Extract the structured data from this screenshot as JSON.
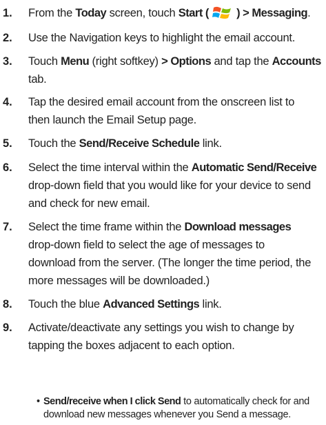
{
  "steps": [
    {
      "num": "1.",
      "parts": [
        {
          "t": "From the "
        },
        {
          "t": "Today",
          "b": true
        },
        {
          "t": " screen, touch "
        },
        {
          "t": "Start",
          "b": true
        },
        {
          "t": " ( ",
          "b": true
        },
        {
          "icon": "windows-start-icon"
        },
        {
          "t": " ) > Messaging",
          "b": true
        },
        {
          "t": "."
        }
      ]
    },
    {
      "num": "2.",
      "parts": [
        {
          "t": "Use the Navigation keys to highlight the email account."
        }
      ]
    },
    {
      "num": "3.",
      "parts": [
        {
          "t": "Touch "
        },
        {
          "t": "Menu",
          "b": true
        },
        {
          "t": " (right softkey) "
        },
        {
          "t": "> Options",
          "b": true
        },
        {
          "t": " and tap the "
        },
        {
          "t": "Accounts",
          "b": true
        },
        {
          "br": true
        },
        {
          "t": "tab."
        }
      ]
    },
    {
      "num": "4.",
      "parts": [
        {
          "t": "Tap the desired email account from the onscreen list to"
        },
        {
          "br": true
        },
        {
          "t": "then launch the Email Setup page."
        }
      ]
    },
    {
      "num": "5.",
      "parts": [
        {
          "t": "Touch the "
        },
        {
          "t": "Send/Receive Schedule",
          "b": true
        },
        {
          "t": " link."
        }
      ]
    },
    {
      "num": "6.",
      "parts": [
        {
          "t": "Select the time interval within the "
        },
        {
          "t": "Automatic Send/Receive",
          "b": true
        },
        {
          "br": true
        },
        {
          "t": "drop-down field that you would like for your device to send"
        },
        {
          "br": true
        },
        {
          "t": "and check for new email."
        }
      ]
    },
    {
      "num": "7.",
      "parts": [
        {
          "t": "Select the time frame within the "
        },
        {
          "t": "Download messages",
          "b": true
        },
        {
          "br": true
        },
        {
          "t": "drop-down field to select the age of messages to"
        },
        {
          "br": true
        },
        {
          "t": "download from the server. (The longer the time period, the"
        },
        {
          "br": true
        },
        {
          "t": "more messages will be downloaded.)"
        }
      ]
    },
    {
      "num": "8.",
      "parts": [
        {
          "t": "Touch the blue "
        },
        {
          "t": "Advanced Settings",
          "b": true
        },
        {
          "t": " link."
        }
      ]
    },
    {
      "num": "9.",
      "parts": [
        {
          "t": "Activate/deactivate any settings you wish to change by"
        },
        {
          "br": true
        },
        {
          "t": "tapping the boxes adjacent to each option."
        }
      ]
    }
  ],
  "bullet": {
    "symbol": "•",
    "parts": [
      {
        "t": "Send/receive when I click Send",
        "b": true
      },
      {
        "t": " to automatically check for and"
      },
      {
        "br": true
      },
      {
        "t": "download new messages whenever you Send a message."
      }
    ]
  }
}
